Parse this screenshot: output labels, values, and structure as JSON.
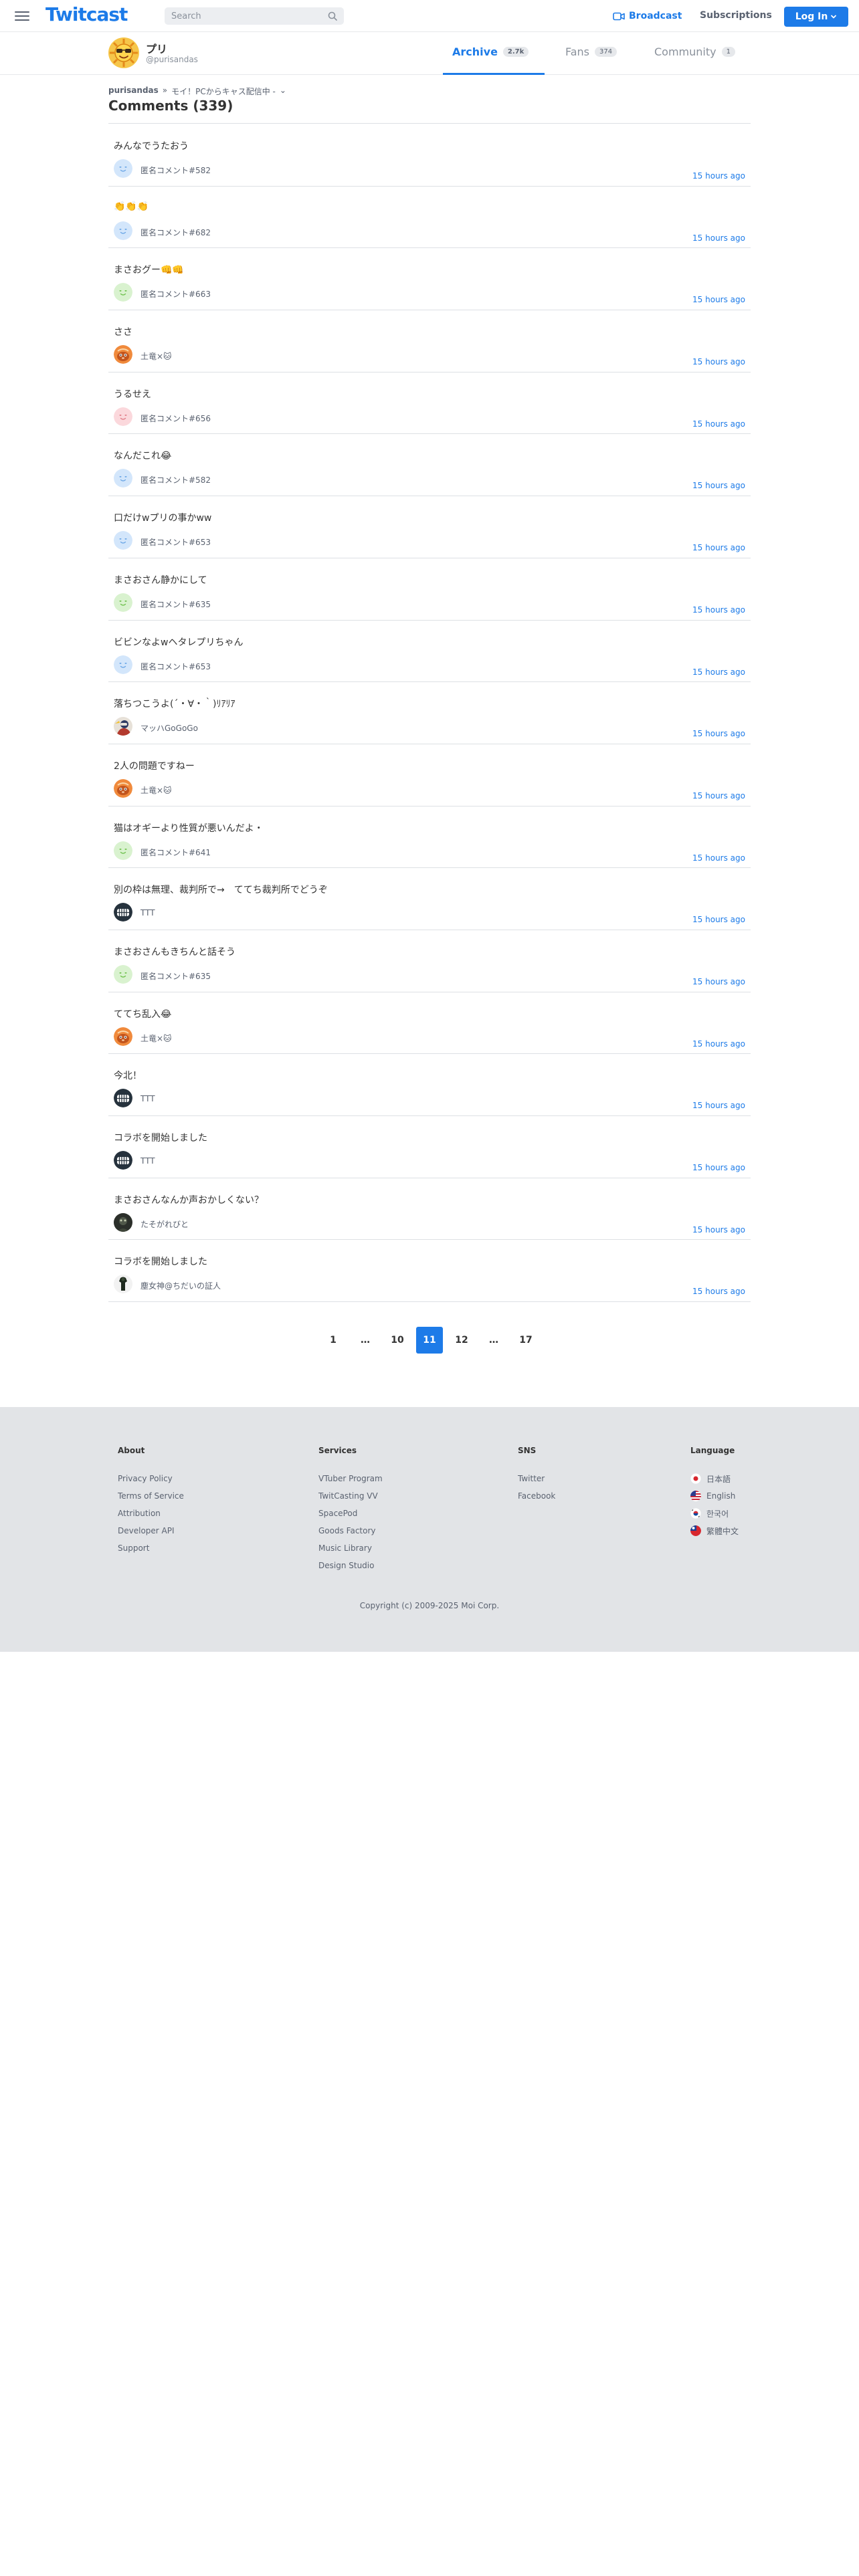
{
  "header": {
    "logo": "Twitcast",
    "search_placeholder": "Search",
    "broadcast_label": "Broadcast",
    "subscriptions_label": "Subscriptions",
    "login_label": "Log In",
    "brand_color": "#1d7be8"
  },
  "profile": {
    "name": "プリ",
    "handle": "@purisandas",
    "tabs": [
      {
        "label": "Archive",
        "count": "2.7k",
        "active": true
      },
      {
        "label": "Fans",
        "count": "374",
        "active": false
      },
      {
        "label": "Community",
        "count": "1",
        "active": false
      }
    ]
  },
  "breadcrumb": {
    "user": "purisandas",
    "separator": "»",
    "movie": "モイ！PCからキャス配信中 -",
    "chevron": "⌄"
  },
  "page": {
    "title": "Comments (339)"
  },
  "comments": [
    {
      "text": "みんなでうたおう",
      "author": "匿名コメント#582",
      "time": "15 hours ago",
      "avatar": "blue"
    },
    {
      "text": "👏👏👏",
      "author": "匿名コメント#682",
      "time": "15 hours ago",
      "avatar": "blue"
    },
    {
      "text": "まさおグー👊👊",
      "author": "匿名コメント#663",
      "time": "15 hours ago",
      "avatar": "green"
    },
    {
      "text": "ささ",
      "author": "土竜×🐱",
      "time": "15 hours ago",
      "avatar": "orange"
    },
    {
      "text": "うるせえ",
      "author": "匿名コメント#656",
      "time": "15 hours ago",
      "avatar": "pink"
    },
    {
      "text": "なんだこれ😂",
      "author": "匿名コメント#582",
      "time": "15 hours ago",
      "avatar": "blue"
    },
    {
      "text": "口だけwプリの事かww",
      "author": "匿名コメント#653",
      "time": "15 hours ago",
      "avatar": "blue"
    },
    {
      "text": "まさおさん静かにして",
      "author": "匿名コメント#635",
      "time": "15 hours ago",
      "avatar": "green"
    },
    {
      "text": "ビビンなよwヘタレプリちゃん",
      "author": "匿名コメント#653",
      "time": "15 hours ago",
      "avatar": "blue"
    },
    {
      "text": "落ちつこうよ(´・∀・｀)ﾘｱﾘｱ",
      "author": "マッハGoGoGo",
      "time": "15 hours ago",
      "avatar": "photo-racer"
    },
    {
      "text": "2人の問題ですねー",
      "author": "土竜×🐱",
      "time": "15 hours ago",
      "avatar": "orange"
    },
    {
      "text": "猫はオギーより性質が悪いんだよ・",
      "author": "匿名コメント#641",
      "time": "15 hours ago",
      "avatar": "green"
    },
    {
      "text": "別の枠は無理、裁判所で→　ててち裁判所でどうぞ",
      "author": "TTT",
      "time": "15 hours ago",
      "avatar": "dark-teeth"
    },
    {
      "text": "まさおさんもきちんと話そう",
      "author": "匿名コメント#635",
      "time": "15 hours ago",
      "avatar": "green"
    },
    {
      "text": "ててち乱入😂",
      "author": "土竜×🐱",
      "time": "15 hours ago",
      "avatar": "orange"
    },
    {
      "text": "今北！",
      "author": "TTT",
      "time": "15 hours ago",
      "avatar": "dark-teeth"
    },
    {
      "text": "コラボを開始しました",
      "author": "TTT",
      "time": "15 hours ago",
      "avatar": "dark-teeth"
    },
    {
      "text": "まさおさんなんか声おかしくない？",
      "author": "たそがれびと",
      "time": "15 hours ago",
      "avatar": "photo-dark"
    },
    {
      "text": "コラボを開始しました",
      "author": "塵女神@ちだいの証人",
      "time": "15 hours ago",
      "avatar": "photo-figure"
    }
  ],
  "pagination": [
    "1",
    "…",
    "10",
    "11",
    "12",
    "…",
    "17"
  ],
  "pagination_active": "11",
  "footer": {
    "columns": [
      {
        "heading": "About",
        "links": [
          "Privacy Policy",
          "Terms of Service",
          "Attribution",
          "Developer API",
          "Support"
        ]
      },
      {
        "heading": "Services",
        "links": [
          "VTuber Program",
          "TwitCasting VV",
          "SpacePod",
          "Goods Factory",
          "Music Library",
          "Design Studio"
        ]
      },
      {
        "heading": "SNS",
        "links": [
          "Twitter",
          "Facebook"
        ]
      },
      {
        "heading": "Language",
        "links": [
          "日本語",
          "English",
          "한국어",
          "繁體中文"
        ]
      }
    ],
    "copyright": "Copyright (c) 2009-2025 Moi Corp."
  }
}
